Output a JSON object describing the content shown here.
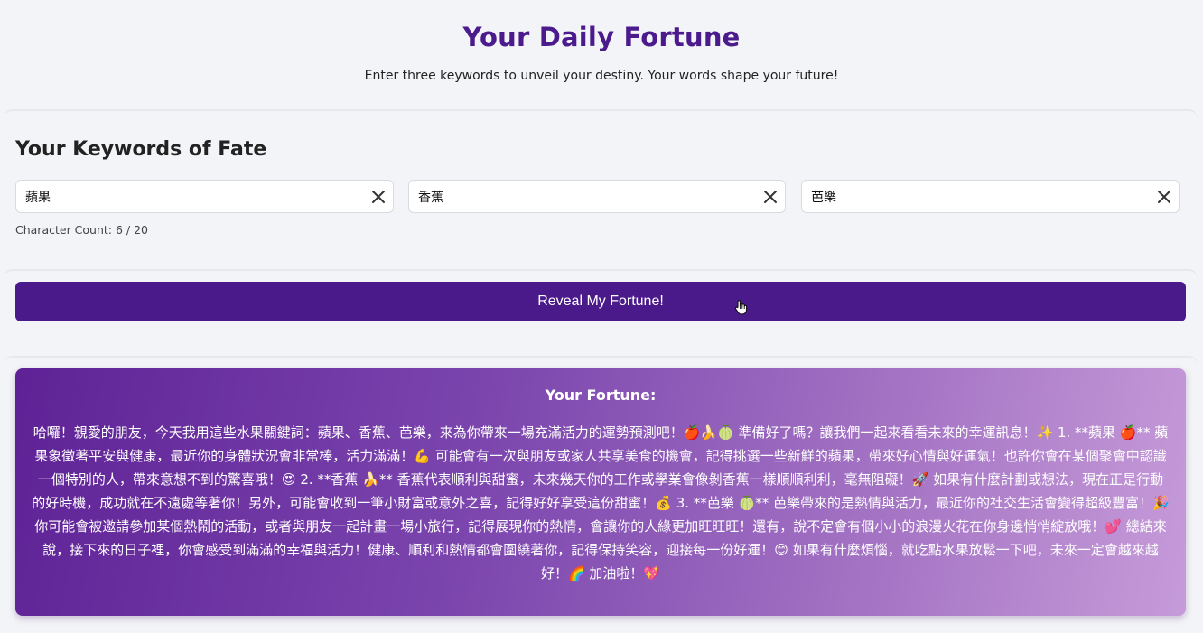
{
  "header": {
    "title": "Your Daily Fortune",
    "subtitle": "Enter three keywords to unveil your destiny. Your words shape your future!"
  },
  "keywords_section": {
    "heading": "Your Keywords of Fate",
    "inputs": [
      {
        "value": "蘋果",
        "clear_icon": "close-x-icon"
      },
      {
        "value": "香蕉",
        "clear_icon": "close-x-icon"
      },
      {
        "value": "芭樂",
        "clear_icon": "close-x-icon"
      }
    ],
    "char_count": "Character Count: 6 / 20"
  },
  "reveal_button": {
    "label": "Reveal My Fortune!",
    "color": "#4a1a8a"
  },
  "fortune": {
    "heading": "Your Fortune:",
    "text": "哈囉！親愛的朋友，今天我用這些水果關鍵詞：蘋果、香蕉、芭樂，來為你帶來一場充滿活力的運勢預測吧！🍎🍌🍈 準備好了嗎？讓我們一起來看看未來的幸運訊息！✨ 1. **蘋果 🍎** 蘋果象徵著平安與健康，最近你的身體狀況會非常棒，活力滿滿！💪 可能會有一次與朋友或家人共享美食的機會，記得挑選一些新鮮的蘋果，帶來好心情與好運氣！也許你會在某個聚會中認識一個特別的人，帶來意想不到的驚喜哦！😍 2. **香蕉 🍌** 香蕉代表順利與甜蜜，未來幾天你的工作或學業會像剝香蕉一樣順順利利，毫無阻礙！🚀 如果有什麼計劃或想法，現在正是行動的好時機，成功就在不遠處等著你！另外，可能會收到一筆小財富或意外之喜，記得好好享受這份甜蜜！💰 3. **芭樂 🍈** 芭樂帶來的是熱情與活力，最近你的社交生活會變得超級豐富！🎉 你可能會被邀請參加某個熱鬧的活動，或者與朋友一起計畫一場小旅行，記得展現你的熱情，會讓你的人緣更加旺旺旺！還有，說不定會有個小小的浪漫火花在你身邊悄悄綻放哦！💕 總結來說，接下來的日子裡，你會感受到滿滿的幸福與活力！健康、順利和熱情都會圍繞著你，記得保持笑容，迎接每一份好運！😊 如果有什麼煩惱，就吃點水果放鬆一下吧，未來一定會越來越好！🌈 加油啦！💖",
    "gradient_start": "#5e2296",
    "gradient_end": "#c69bd9"
  },
  "cursor": {
    "icon": "hand-pointer-icon"
  }
}
